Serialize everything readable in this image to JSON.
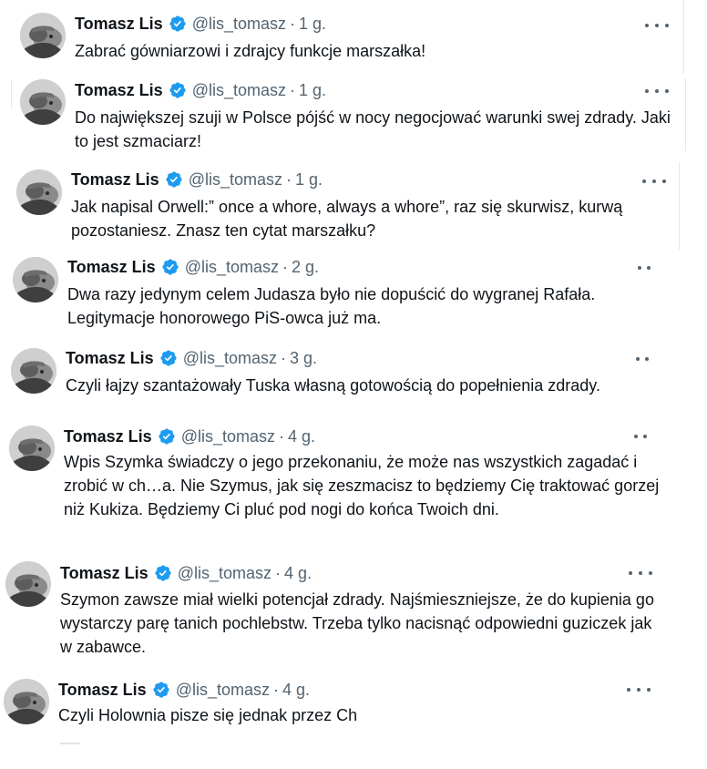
{
  "tweets": [
    {
      "author": "Tomasz Lis",
      "handle": "@lis_tomasz",
      "time": "1 g.",
      "text": "Zabrać gówniarzowi i zdrajcy funkcje marszałka!"
    },
    {
      "author": "Tomasz Lis",
      "handle": "@lis_tomasz",
      "time": "1 g.",
      "text": "Do największej szuji w Polsce pójść w nocy negocjować warunki swej zdrady. Jaki to jest szmaciarz!"
    },
    {
      "author": "Tomasz Lis",
      "handle": "@lis_tomasz",
      "time": "1 g.",
      "text": "Jak napisal Orwell:” once a whore, always a whore”,  raz się skurwisz, kurwą pozostaniesz. Znasz ten cytat marszałku?"
    },
    {
      "author": "Tomasz Lis",
      "handle": "@lis_tomasz",
      "time": "2 g.",
      "text": "Dwa razy jedynym celem Judasza było nie dopuścić do wygranej Rafała. Legitymacje honorowego PiS-owca już ma."
    },
    {
      "author": "Tomasz Lis",
      "handle": "@lis_tomasz",
      "time": "3 g.",
      "text": "Czyli łajzy szantażowały Tuska własną gotowością do popełnienia zdrady."
    },
    {
      "author": "Tomasz Lis",
      "handle": "@lis_tomasz",
      "time": "4 g.",
      "text": "Wpis Szymka świadczy o jego przekonaniu, że może nas wszystkich zagadać i zrobić w ch…a. Nie Szymus, jak się zeszmacisz to będziemy Cię traktować  gorzej niż Kukiza. Będziemy Ci pluć pod nogi do końca Twoich dni."
    },
    {
      "author": "Tomasz Lis",
      "handle": "@lis_tomasz",
      "time": "4 g.",
      "text": "Szymon zawsze miał wielki potencjał zdrady. Najśmieszniejsze, że do kupienia go wystarczy parę tanich pochlebstw. Trzeba tylko nacisnąć odpowiedni guziczek jak w zabawce."
    },
    {
      "author": "Tomasz Lis",
      "handle": "@lis_tomasz",
      "time": "4 g.",
      "text": "Czyli Holownia pisze się jednak przez Ch"
    }
  ],
  "colors": {
    "verified": "#1d9bf0",
    "text": "#0f1419",
    "secondary": "#536471"
  },
  "icons": {
    "verified": "verified-badge-icon",
    "more": "more-options-icon"
  }
}
